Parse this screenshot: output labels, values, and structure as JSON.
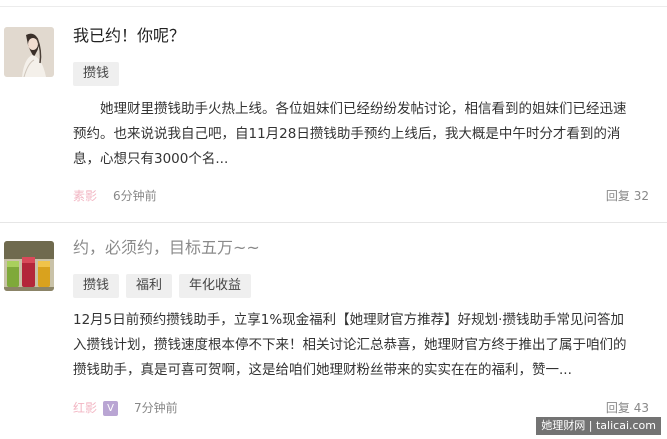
{
  "posts": [
    {
      "title": "我已约！你呢？",
      "tags": [
        "攒钱"
      ],
      "excerpt_lines": [
        "　　她理财里攒钱助手火热上线。各位姐妹们已经纷纷发帖讨论，相信看到的姐妹们已经迅速",
        "预约。也来说说我自己吧，自11月28日攒钱助手预约上线后，我大概是中午时分才看到的消",
        "息，心想只有3000个名..."
      ],
      "author": "素影",
      "time": "6分钟前",
      "replies": "回复 32",
      "avatar_icon": "woman-portrait-avatar"
    },
    {
      "title": "约，必须约，目标五万~~",
      "tags": [
        "攒钱",
        "福利",
        "年化收益"
      ],
      "excerpt_lines": [
        "12月5日前预约攒钱助手，立享1%现金福利【她理财官方推荐】好规划·攒钱助手常见问答加",
        "入攒钱计划，攒钱速度根本停不下来！相关讨论汇总恭喜，她理财官方终于推出了属于咱们的",
        "攒钱助手，真是可喜可贺啊，这是给咱们她理财粉丝带来的实实在在的福利，赞一..."
      ],
      "author": "红影",
      "badge": "V",
      "time": "7分钟前",
      "replies": "回复 43",
      "avatar_icon": "drinks-avatar"
    }
  ],
  "watermark": "她理财网 | talicai.com",
  "colors": {
    "author": "#f2b6c3",
    "badge": "#b9a5d3",
    "tag_bg": "#efefef",
    "muted_title": "#8a8a8a"
  }
}
